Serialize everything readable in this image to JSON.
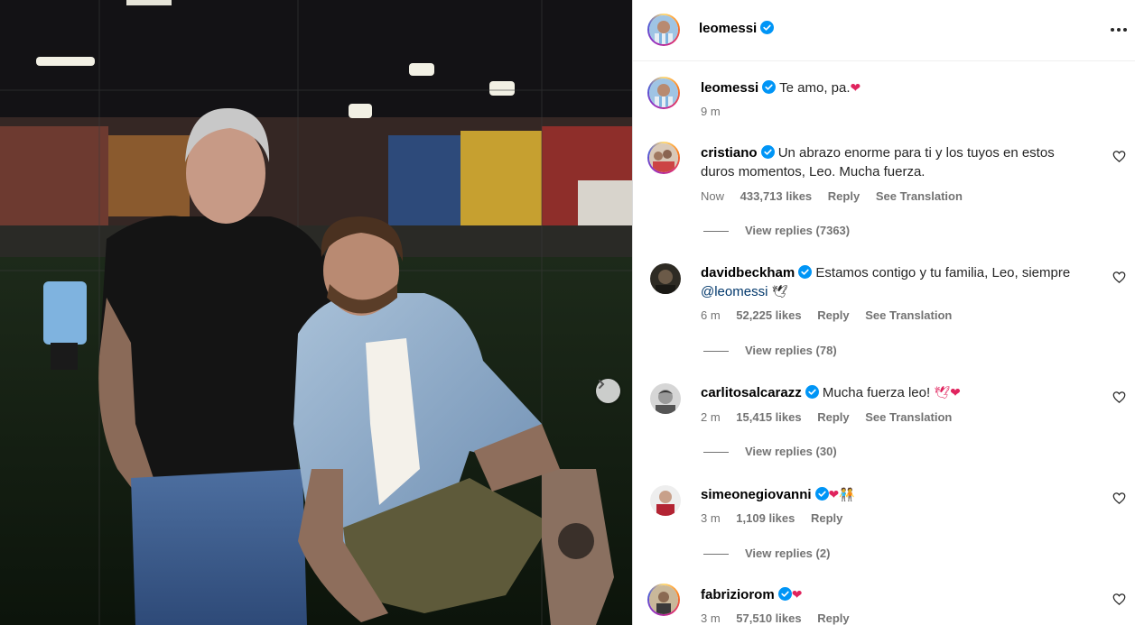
{
  "post": {
    "author": "leomessi",
    "caption": "Te amo, pa.",
    "caption_emoji": "❤",
    "time": "9 m"
  },
  "comments": [
    {
      "user": "cristiano",
      "text": "Un abrazo enorme para ti y los tuyos en estos duros momentos, Leo. Mucha fuerza.",
      "time": "Now",
      "likes": "433,713 likes",
      "reply": "Reply",
      "translate": "See Translation",
      "view_replies": "View replies (7363)"
    },
    {
      "user": "davidbeckham",
      "text": "Estamos contigo y tu familia, Leo, siempre",
      "mention": "@leomessi",
      "emoji": "🕊",
      "time": "6 m",
      "likes": "52,225 likes",
      "reply": "Reply",
      "translate": "See Translation",
      "view_replies": "View replies (78)"
    },
    {
      "user": "carlitosalcarazz",
      "text": "Mucha fuerza leo!",
      "emoji": "🕊❤",
      "time": "2 m",
      "likes": "15,415 likes",
      "reply": "Reply",
      "translate": "See Translation",
      "view_replies": "View replies (30)"
    },
    {
      "user": "simeonegiovanni",
      "text": "",
      "emoji": "❤🧑‍🤝‍🧑",
      "time": "3 m",
      "likes": "1,109 likes",
      "reply": "Reply",
      "view_replies": "View replies (2)"
    },
    {
      "user": "fabriziorom",
      "text": "",
      "emoji": "❤",
      "time": "3 m",
      "likes": "57,510 likes",
      "reply": "Reply"
    }
  ],
  "colors": {
    "verified": "#0095f6",
    "secondary_text": "#737373",
    "mention": "#00376b",
    "heart_emoji": "#e0245e"
  },
  "icons": {
    "more": "more-horizontal-icon",
    "like": "heart-outline-icon",
    "next": "chevron-right-icon",
    "verified": "verified-badge-icon"
  }
}
